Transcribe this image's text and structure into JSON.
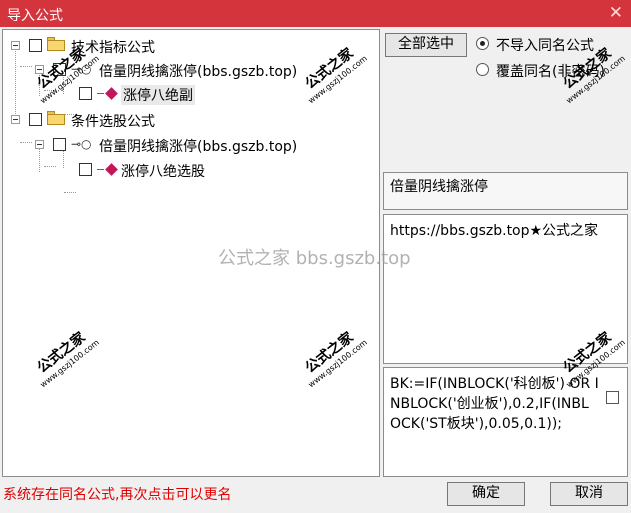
{
  "window": {
    "title": "导入公式",
    "close_glyph": "✕"
  },
  "tree": {
    "nodes": [
      {
        "label": "技术指标公式"
      },
      {
        "label": "倍量阴线擒涨停(bbs.gszb.top)"
      },
      {
        "label": "涨停八绝副"
      },
      {
        "label": "条件选股公式"
      },
      {
        "label": "倍量阴线擒涨停(bbs.gszb.top)"
      },
      {
        "label": "涨停八绝选股"
      }
    ]
  },
  "options": {
    "select_all_label": "全部选中",
    "radio_skip_label": "不导入同名公式",
    "radio_overwrite_label": "覆盖同名(非密码)",
    "selected_radio": "skip"
  },
  "details": {
    "name": "倍量阴线擒涨停",
    "description": "https://bbs.gszb.top★公式之家",
    "code": "BK:=IF(INBLOCK('科创板') OR INBLOCK('创业板'),0.2,IF(INBLOCK('ST板块'),0.05,0.1));"
  },
  "footer": {
    "status_text": "系统存在同名公式,再次点击可以更名",
    "ok_label": "确定",
    "cancel_label": "取消"
  },
  "watermarks": {
    "center_text": "公式之家 bbs.gszb.top",
    "stamp_big": "公式之家",
    "stamp_small": "www.gszj100.com"
  },
  "colors": {
    "titlebar": "#d4343c",
    "status_text": "#e00000"
  }
}
